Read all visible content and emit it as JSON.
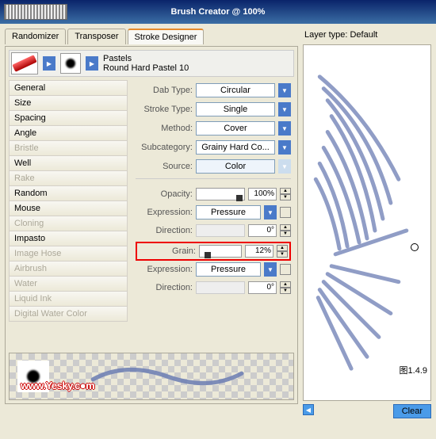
{
  "title": "Brush Creator @ 100%",
  "tabs": [
    "Randomizer",
    "Transposer",
    "Stroke Designer"
  ],
  "brush": {
    "category": "Pastels",
    "variant": "Round Hard Pastel 10"
  },
  "sidebar": {
    "items": [
      {
        "label": "General",
        "disabled": false
      },
      {
        "label": "Size",
        "disabled": false
      },
      {
        "label": "Spacing",
        "disabled": false
      },
      {
        "label": "Angle",
        "disabled": false
      },
      {
        "label": "Bristle",
        "disabled": true
      },
      {
        "label": "Well",
        "disabled": false
      },
      {
        "label": "Rake",
        "disabled": true
      },
      {
        "label": "Random",
        "disabled": false
      },
      {
        "label": "Mouse",
        "disabled": false
      },
      {
        "label": "Cloning",
        "disabled": true
      },
      {
        "label": "Impasto",
        "disabled": false
      },
      {
        "label": "Image Hose",
        "disabled": true
      },
      {
        "label": "Airbrush",
        "disabled": true
      },
      {
        "label": "Water",
        "disabled": true
      },
      {
        "label": "Liquid Ink",
        "disabled": true
      },
      {
        "label": "Digital Water Color",
        "disabled": true
      }
    ]
  },
  "controls": {
    "dabType": {
      "label": "Dab Type:",
      "value": "Circular"
    },
    "strokeType": {
      "label": "Stroke Type:",
      "value": "Single"
    },
    "method": {
      "label": "Method:",
      "value": "Cover"
    },
    "subcategory": {
      "label": "Subcategory:",
      "value": "Grainy Hard Co..."
    },
    "source": {
      "label": "Source:",
      "value": "Color"
    },
    "opacity": {
      "label": "Opacity:",
      "value": "100%"
    },
    "expression1": {
      "label": "Expression:",
      "value": "Pressure"
    },
    "direction1": {
      "label": "Direction:",
      "value": "0°"
    },
    "grain": {
      "label": "Grain:",
      "value": "12%"
    },
    "expression2": {
      "label": "Expression:",
      "value": "Pressure"
    },
    "direction2": {
      "label": "Direction:",
      "value": "0°"
    }
  },
  "layerType": {
    "label": "Layer type:",
    "value": "Default"
  },
  "clear": "Clear",
  "figLabel": "图1.4.9",
  "watermark": "www.Yesky.c●m"
}
